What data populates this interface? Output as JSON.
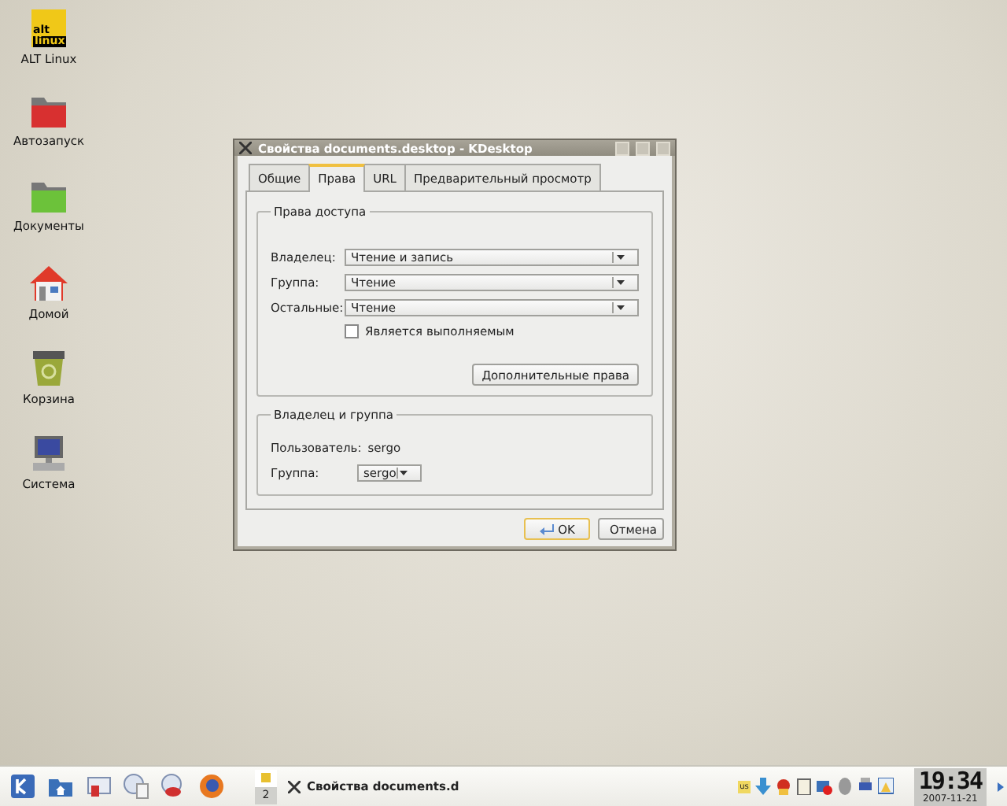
{
  "desktop_icons": [
    {
      "label": "ALT Linux",
      "kind": "logo",
      "logo": [
        "alt",
        "linux"
      ]
    },
    {
      "label": "Автозапуск",
      "kind": "folder",
      "color": "#d83030"
    },
    {
      "label": "Документы",
      "kind": "folder",
      "color": "#6cc23a"
    },
    {
      "label": "Домой",
      "kind": "home"
    },
    {
      "label": "Корзина",
      "kind": "trash"
    },
    {
      "label": "Система",
      "kind": "computer"
    }
  ],
  "dialog": {
    "title": "Свойства documents.desktop - KDesktop",
    "tabs": [
      {
        "label": "Общие",
        "selected": false
      },
      {
        "label": "Права",
        "selected": true
      },
      {
        "label": "URL",
        "selected": false
      },
      {
        "label": "Предварительный просмотр",
        "selected": false
      }
    ],
    "permissions": {
      "title": "Права доступа",
      "rows": [
        {
          "label": "Владелец:",
          "value": "Чтение и запись"
        },
        {
          "label": "Группа:",
          "value": "Чтение"
        },
        {
          "label": "Остальные:",
          "value": "Чтение"
        }
      ],
      "checkbox": {
        "label": "Является выполняемым",
        "checked": false
      },
      "button": "Дополнительные права"
    },
    "ownership": {
      "title": "Владелец и группа",
      "user_label": "Пользователь:",
      "user": "sergo",
      "group_label": "Группа:",
      "group": "sergo"
    },
    "buttons": [
      {
        "label": "OK",
        "kind": "ok",
        "default": true
      },
      {
        "label": "Отмена",
        "kind": "cancel",
        "default": false
      }
    ]
  },
  "taskbar": {
    "pager": [
      {
        "selected": true
      },
      {
        "label": "2",
        "selected": false
      }
    ],
    "task": "Свойства documents.d",
    "keyboard": "us",
    "clock": "19:34",
    "date": "2007-11-21"
  }
}
